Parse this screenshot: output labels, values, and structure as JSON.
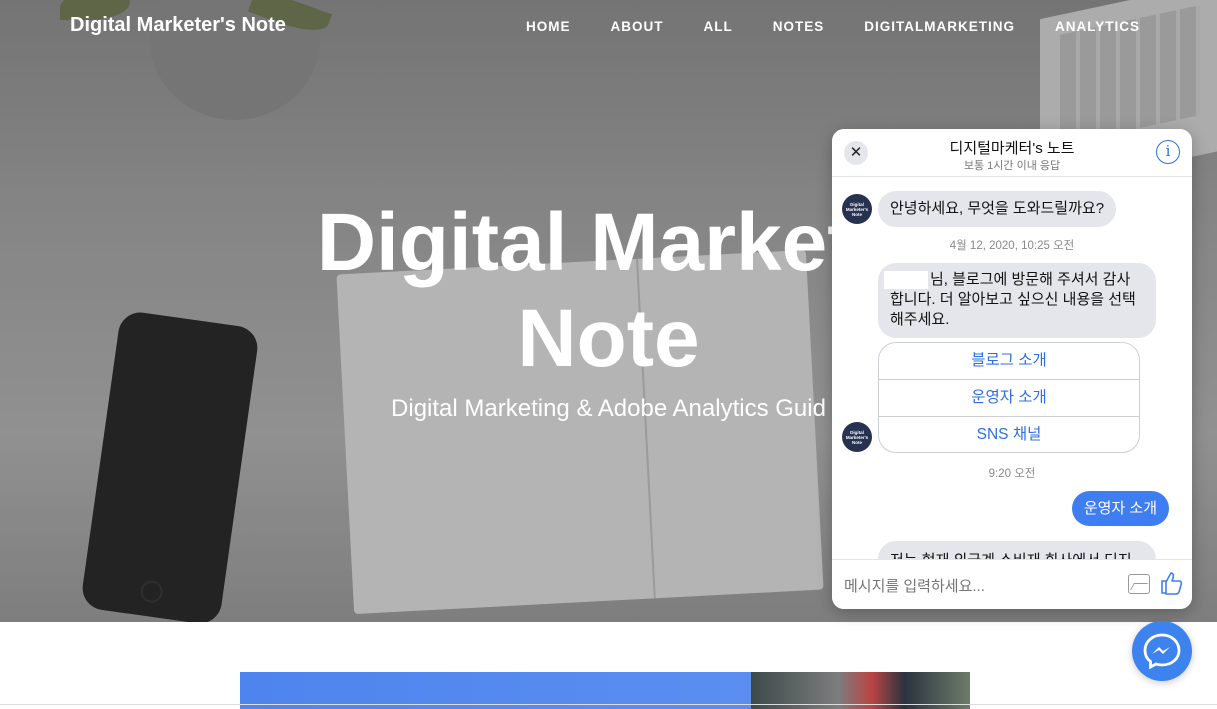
{
  "site": {
    "brand": "Digital Marketer's Note",
    "nav": [
      "HOME",
      "ABOUT",
      "ALL",
      "NOTES",
      "DIGITALMARKETING",
      "ANALYTICS"
    ],
    "hero_title_line1": "Digital Markete",
    "hero_title_line2": "Note",
    "hero_subtitle": "Digital Marketing & Adobe Analytics Guid"
  },
  "chat": {
    "title": "디지털마케터's 노트",
    "status": "보통 1시간 이내 응답",
    "avatar_text": "Digital Marketer's Note",
    "messages": {
      "greeting": "안녕하세요, 무엇을 도와드릴까요?",
      "timestamp1": "4월 12, 2020, 10:25 오전",
      "welcome": "님, 블로그에 방문해 주셔서 감사합니다. 더 알아보고 싶으신 내용을 선택해주세요.",
      "welcome_line1": "님, 블로그에 방문해 주셔서 감사",
      "welcome_line2": "합니다. 더 알아보고 싶으신 내용을 선택",
      "welcome_line3": "해주세요.",
      "timestamp2": "9:20 오전",
      "user_reply": "운영자 소개",
      "partial_reply": "저는 현재 외국계 소비재 회사에서 디지"
    },
    "quick_replies": [
      "블로그 소개",
      "운영자 소개",
      "SNS 채널"
    ],
    "input_placeholder": "메시지를 입력하세요..."
  },
  "colors": {
    "accent": "#3f7ef0",
    "link": "#2d6fe0",
    "bubble": "#e4e6eb"
  },
  "icons": [
    "close-icon",
    "info-icon",
    "image-icon",
    "like-icon",
    "messenger-icon"
  ]
}
